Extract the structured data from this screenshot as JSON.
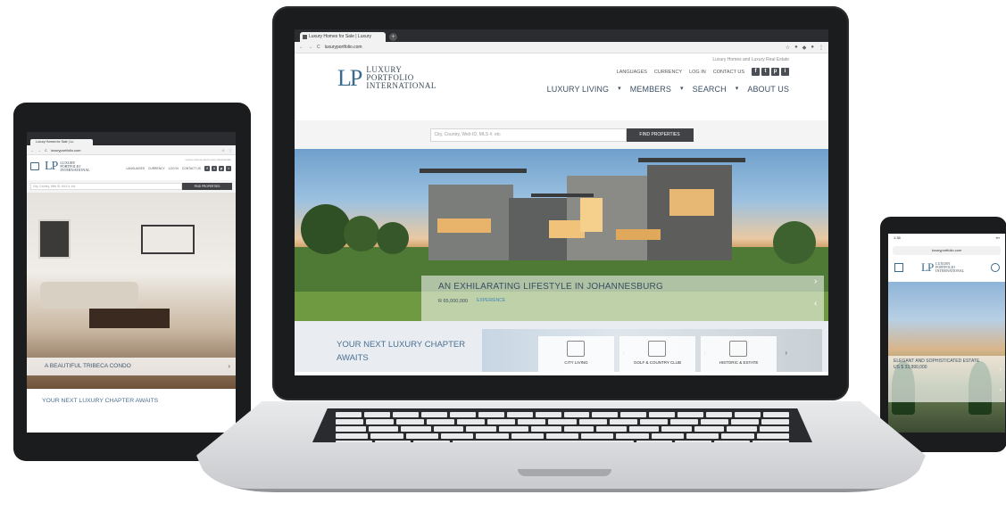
{
  "laptop": {
    "tab_title": "Luxury Homes for Sale | Luxury",
    "url": "luxuryportfolio.com",
    "logo_mark": "LP",
    "logo_lines": [
      "LUXURY",
      "PORTFOLIO",
      "INTERNATIONAL"
    ],
    "tagline": "Luxury Homes and Luxury Real Estate",
    "util_nav": [
      "LANGUAGES",
      "CURRENCY",
      "LOG IN",
      "CONTACT US"
    ],
    "social_icons": [
      "f",
      "t",
      "p",
      "i"
    ],
    "main_nav": [
      "LUXURY LIVING",
      "MEMBERS",
      "SEARCH",
      "ABOUT US"
    ],
    "search_placeholder": "City, Country, Web ID, MLS #, etc",
    "search_button": "FIND PROPERTIES",
    "hero_title": "AN EXHILARATING LIFESTYLE IN JOHANNESBURG",
    "hero_price": "R 65,000,000",
    "hero_link": "EXPERIENCE",
    "section_title": "YOUR NEXT LUXURY CHAPTER AWAITS",
    "categories": [
      "CITY LIVING",
      "GOLF & COUNTRY CLUB",
      "HISTORIC & ESTATE"
    ]
  },
  "tablet": {
    "tab_title": "Luxury Homes for Sale | Lu",
    "url": "luxuryportfolio.com",
    "logo_mark": "LP",
    "logo_lines": [
      "LUXURY",
      "PORTFOLIO",
      "INTERNATIONAL"
    ],
    "tagline": "Luxury Homes and Luxury Real Estate",
    "util_nav": [
      "LANGUAGES",
      "CURRENCY",
      "LOG IN",
      "CONTACT US"
    ],
    "social_icons": [
      "f",
      "t",
      "p",
      "i"
    ],
    "search_placeholder": "City, Country, Web ID, MLS #, etc",
    "search_button": "FIND PROPERTIES",
    "hero_caption": "A BEAUTIFUL TRIBECA CONDO",
    "section_title": "YOUR NEXT LUXURY CHAPTER AWAITS"
  },
  "phone": {
    "time": "1:38",
    "url": "luxuryportfolio.com",
    "logo_mark": "LP",
    "logo_lines": [
      "LUXURY",
      "PORTFOLIO",
      "INTERNATIONAL"
    ],
    "hero_title": "ELEGANT AND SOPHISTICATED ESTATE",
    "hero_price": "US $ 33,990,000"
  },
  "colors": {
    "brand_blue": "#3b6a8c",
    "nav_text": "#3c4f63",
    "device_frame": "#1b1c1e"
  }
}
